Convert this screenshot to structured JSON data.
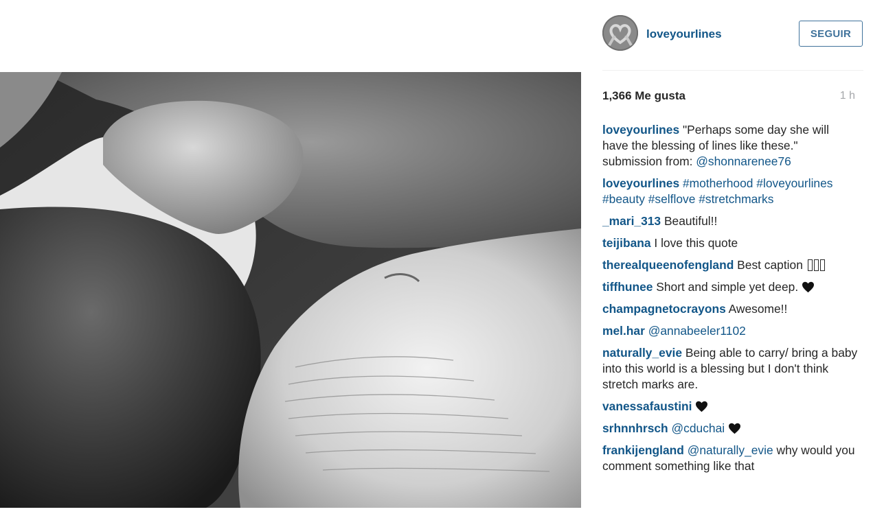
{
  "post": {
    "owner": "loveyourlines",
    "follow_label": "SEGUIR",
    "likes": "1,366 Me gusta",
    "time": "1 h"
  },
  "comments": [
    {
      "user": "loveyourlines",
      "parts": [
        {
          "type": "text",
          "value": "\"Perhaps some day she will have the blessing of lines like these.\" submission from: "
        },
        {
          "type": "mention",
          "value": "@shonnarenee76"
        }
      ]
    },
    {
      "user": "loveyourlines",
      "parts": [
        {
          "type": "tag",
          "value": "#motherhood"
        },
        {
          "type": "text",
          "value": " "
        },
        {
          "type": "tag",
          "value": "#loveyourlines"
        },
        {
          "type": "text",
          "value": " "
        },
        {
          "type": "tag",
          "value": "#beauty"
        },
        {
          "type": "text",
          "value": " "
        },
        {
          "type": "tag",
          "value": "#selflove"
        },
        {
          "type": "text",
          "value": " "
        },
        {
          "type": "tag",
          "value": "#stretchmarks"
        }
      ]
    },
    {
      "user": "_mari_313",
      "parts": [
        {
          "type": "text",
          "value": "Beautiful!!"
        }
      ]
    },
    {
      "user": "teijibana",
      "parts": [
        {
          "type": "text",
          "value": "I love this quote"
        }
      ]
    },
    {
      "user": "therealqueenofengland",
      "parts": [
        {
          "type": "text",
          "value": "Best caption"
        },
        {
          "type": "box",
          "value": "3"
        }
      ]
    },
    {
      "user": "tiffhunee",
      "parts": [
        {
          "type": "text",
          "value": "Short and simple yet deep. "
        },
        {
          "type": "heart",
          "value": "heart"
        }
      ]
    },
    {
      "user": "champagnetocrayons",
      "parts": [
        {
          "type": "text",
          "value": "Awesome!!"
        }
      ]
    },
    {
      "user": "mel.har",
      "parts": [
        {
          "type": "mention",
          "value": "@annabeeler1102"
        }
      ]
    },
    {
      "user": "naturally_evie",
      "parts": [
        {
          "type": "text",
          "value": "Being able to carry/ bring a baby into this world is a blessing but I don't think stretch marks are."
        }
      ]
    },
    {
      "user": "vanessafaustini",
      "parts": [
        {
          "type": "heart",
          "value": "heart"
        }
      ]
    },
    {
      "user": "srhnnhrsch",
      "parts": [
        {
          "type": "mention",
          "value": "@cduchai"
        },
        {
          "type": "text",
          "value": " "
        },
        {
          "type": "heart",
          "value": "heart"
        }
      ]
    },
    {
      "user": "frankijengland",
      "parts": [
        {
          "type": "mention",
          "value": "@naturally_evie"
        },
        {
          "type": "text",
          "value": " why would you comment something like that"
        }
      ]
    }
  ],
  "colors": {
    "link": "#125688",
    "button": "#3f729b",
    "muted": "#a5a7aa"
  },
  "icons": {
    "avatar": "heart-hands-avatar",
    "heart": "black-heart-icon"
  }
}
